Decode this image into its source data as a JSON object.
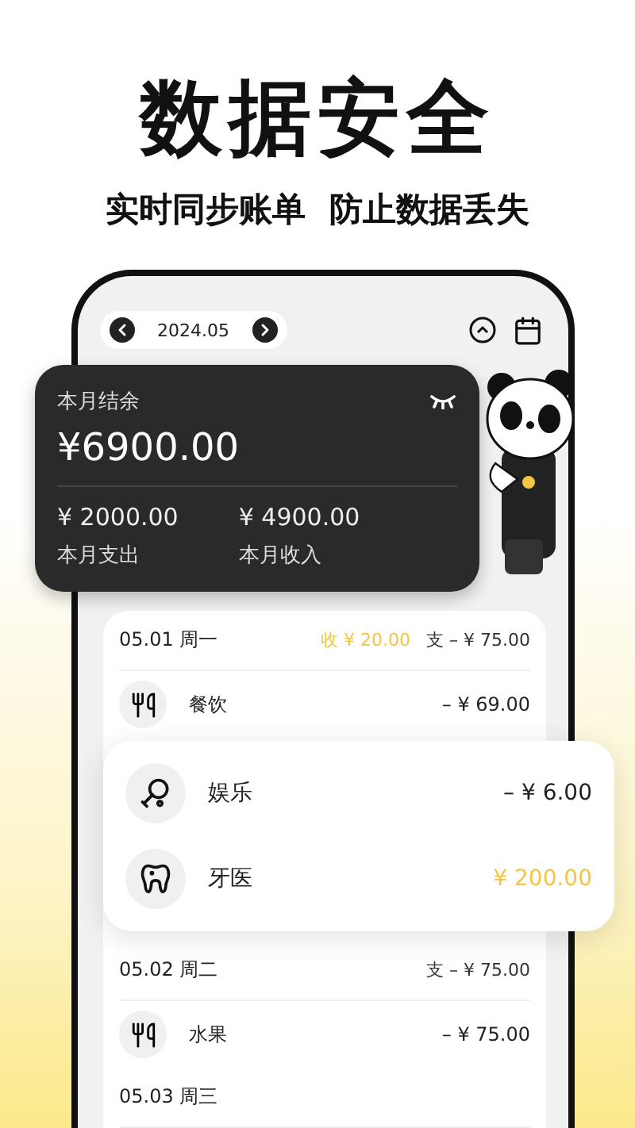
{
  "headline": "数据安全",
  "subtitle": "实时同步账单  防止数据丢失",
  "month_nav": {
    "label": "2024.05"
  },
  "balance": {
    "label": "本月结余",
    "amount": "¥6900.00",
    "expense": {
      "amount": "¥ 2000.00",
      "label": "本月支出"
    },
    "income": {
      "amount": "¥ 4900.00",
      "label": "本月收入"
    }
  },
  "days": [
    {
      "date": "05.01 周一",
      "income": "收 ¥ 20.00",
      "expense": "支 – ¥ 75.00",
      "entries": [
        {
          "kind": "food",
          "name": "餐饮",
          "amount": "– ¥ 69.00",
          "income": false
        }
      ],
      "popup": [
        {
          "kind": "entertainment",
          "name": "娱乐",
          "amount": "– ¥ 6.00",
          "income": false
        },
        {
          "kind": "dental",
          "name": "牙医",
          "amount": "¥ 200.00",
          "income": true
        }
      ]
    },
    {
      "date": "05.02 周二",
      "expense": "支 – ¥ 75.00",
      "entries": [
        {
          "kind": "food",
          "name": "水果",
          "amount": "– ¥ 75.00",
          "income": false
        }
      ]
    },
    {
      "date": "05.03 周三"
    }
  ]
}
